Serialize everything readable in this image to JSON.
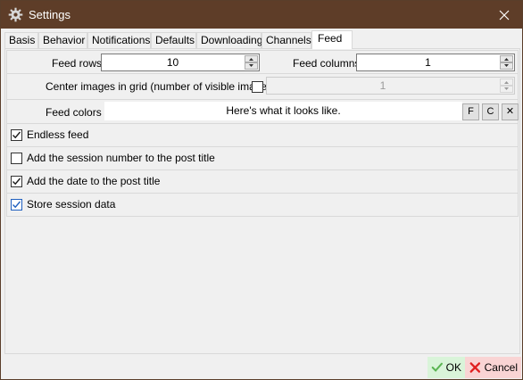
{
  "window": {
    "title": "Settings",
    "close_glyph": "✕"
  },
  "tabs": [
    {
      "label": "Basis"
    },
    {
      "label": "Behavior"
    },
    {
      "label": "Notifications"
    },
    {
      "label": "Defaults"
    },
    {
      "label": "Downloading"
    },
    {
      "label": "Channels"
    },
    {
      "label": "Feed"
    }
  ],
  "active_tab": "Feed",
  "feed": {
    "rows_label": "Feed rows",
    "rows_value": "10",
    "columns_label": "Feed columns",
    "columns_value": "1",
    "center_label": "Center images in grid (number of visible images)",
    "center_checked": false,
    "center_value": "1",
    "colors_label": "Feed colors",
    "colors_preview": "Here's what it looks like.",
    "color_btn_f": "F",
    "color_btn_c": "C",
    "color_btn_x": "✕",
    "options": [
      {
        "label": "Endless feed",
        "checked": true
      },
      {
        "label": "Add the session number to the post title",
        "checked": false
      },
      {
        "label": "Add the date to the post title",
        "checked": true
      },
      {
        "label": "Store session data",
        "checked": true
      }
    ]
  },
  "footer": {
    "ok_label": "OK",
    "cancel_label": "Cancel"
  },
  "colors": {
    "titlebar": "#5e3d28",
    "ok_bg": "#d9f4d9",
    "cancel_bg": "#f9d4d4",
    "check": "#1f5fbf"
  },
  "icons": {
    "app": "gear-icon",
    "close": "close-icon",
    "ok": "checkmark-icon",
    "cancel": "cross-icon"
  }
}
